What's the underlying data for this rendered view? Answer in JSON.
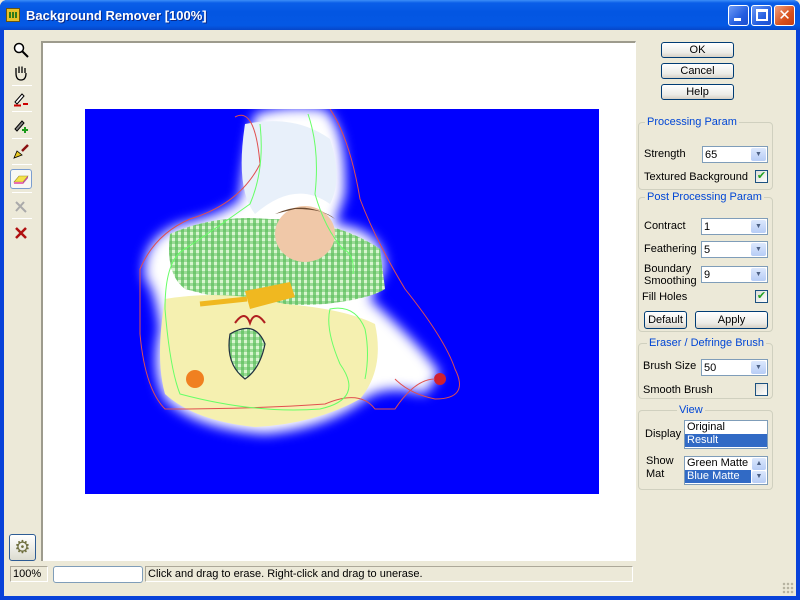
{
  "window": {
    "title": "Background Remover [100%]",
    "controls": {
      "minimize": "minimize",
      "maximize": "maximize",
      "close": "✕"
    }
  },
  "toolbar": {
    "tools": [
      {
        "name": "zoom-tool",
        "icon": "🔍",
        "active": false
      },
      {
        "name": "hand-tool",
        "icon": "✋",
        "active": false
      },
      {
        "name": "remove-marker-tool",
        "icon": "✎",
        "active": false
      },
      {
        "name": "keep-marker-tool",
        "icon": "✎",
        "active": false
      },
      {
        "name": "brush-tool",
        "icon": "🖌",
        "active": false
      },
      {
        "name": "eraser-tool",
        "icon": "▰",
        "active": true
      },
      {
        "name": "defringe-tool",
        "icon": "✕",
        "active": false
      },
      {
        "name": "clear-tool",
        "icon": "✖",
        "active": false
      }
    ],
    "settings_icon": "⚙"
  },
  "buttons": {
    "ok": "OK",
    "cancel": "Cancel",
    "help": "Help",
    "default": "Default",
    "apply": "Apply"
  },
  "processing": {
    "title": "Processing Param",
    "strength_label": "Strength",
    "strength_value": "65",
    "textured_label": "Textured Background",
    "textured_checked": "✔"
  },
  "post_processing": {
    "title": "Post Processing Param",
    "contract_label": "Contract",
    "contract_value": "1",
    "feathering_label": "Feathering",
    "feathering_value": "5",
    "boundary_label_1": "Boundary",
    "boundary_label_2": "Smoothing",
    "boundary_value": "9",
    "fill_holes_label": "Fill Holes",
    "fill_holes_checked": "✔"
  },
  "brush": {
    "title": "Eraser / Defringe  Brush",
    "size_label": "Brush Size",
    "size_value": "50",
    "smooth_label": "Smooth Brush",
    "smooth_checked": ""
  },
  "view": {
    "title": "View",
    "display_label": "Display",
    "display_options": [
      "Original",
      "Result"
    ],
    "display_selected": "Result",
    "show_mat_label_1": "Show",
    "show_mat_label_2": "Mat",
    "mat_options": [
      "Green Matte",
      "Blue Matte"
    ],
    "mat_selected": "Blue Matte"
  },
  "status": {
    "zoom": "100%",
    "progress": 0,
    "message": "Click and drag to erase. Right-click and drag to unerase."
  },
  "canvas": {
    "matte_color": "#0000ff",
    "keep_outline_color": "#66ff66",
    "remove_outline_color": "#e05050"
  }
}
